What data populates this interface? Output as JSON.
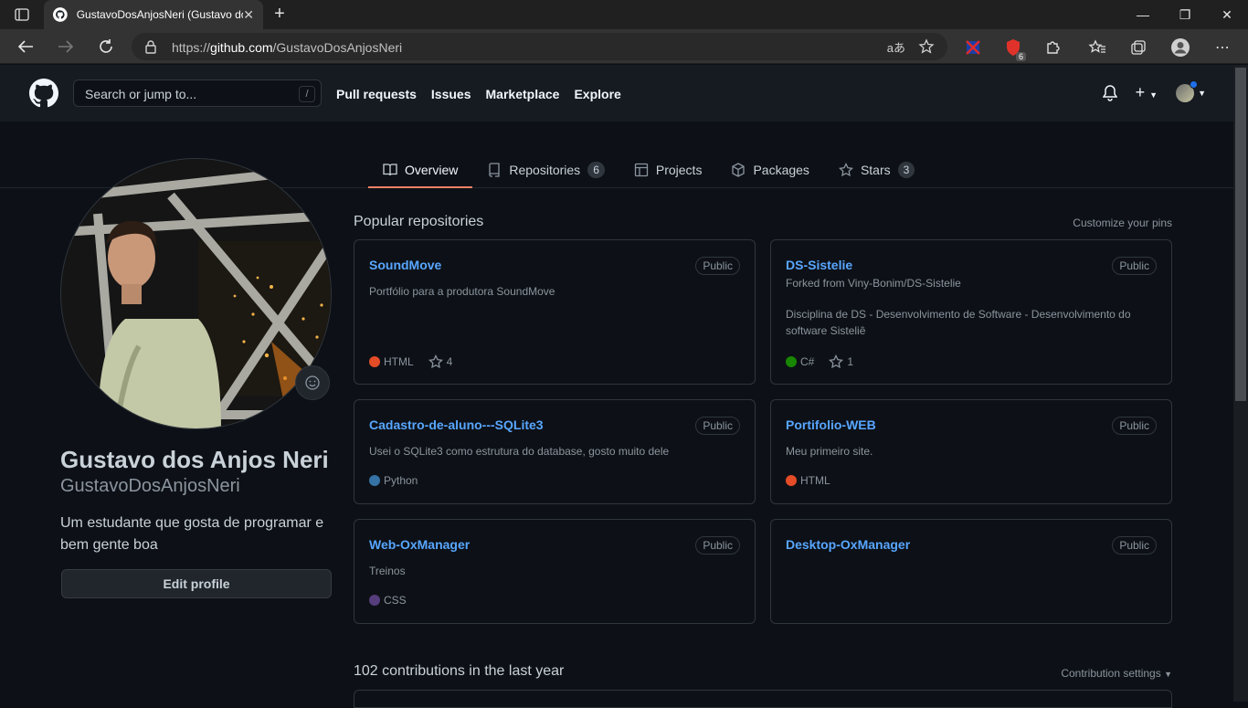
{
  "browser": {
    "tab_title": "GustavoDosAnjosNeri (Gustavo dos Anjos Neri)",
    "url_prefix": "https://",
    "url_host": "github.com",
    "url_path": "/GustavoDosAnjosNeri",
    "read_aloud": "aあ",
    "extension_badge": "6"
  },
  "header": {
    "search_placeholder": "Search or jump to...",
    "search_key": "/",
    "nav": [
      "Pull requests",
      "Issues",
      "Marketplace",
      "Explore"
    ]
  },
  "profile_tabs": [
    {
      "label": "Overview",
      "count": null
    },
    {
      "label": "Repositories",
      "count": "6"
    },
    {
      "label": "Projects",
      "count": null
    },
    {
      "label": "Packages",
      "count": null
    },
    {
      "label": "Stars",
      "count": "3"
    }
  ],
  "profile": {
    "full_name": "Gustavo dos Anjos Neri",
    "username": "GustavoDosAnjosNeri",
    "bio": "Um estudante que gosta de programar e bem gente boa",
    "edit_label": "Edit profile"
  },
  "popular": {
    "title": "Popular repositories",
    "customize": "Customize your pins"
  },
  "repos": [
    {
      "name": "SoundMove",
      "visibility": "Public",
      "forked": "",
      "desc": "Portfólio para a produtora SoundMove",
      "lang": "HTML",
      "lang_color": "#e34c26",
      "stars": "4"
    },
    {
      "name": "DS-Sistelie",
      "visibility": "Public",
      "forked": "Forked from Viny-Bonim/DS-Sistelie",
      "desc": "Disciplina de DS - Desenvolvimento de Software - Desenvolvimento do software Sisteliê",
      "lang": "C#",
      "lang_color": "#178600",
      "stars": "1"
    },
    {
      "name": "Cadastro-de-aluno---SQLite3",
      "visibility": "Public",
      "forked": "",
      "desc": "Usei o SQLite3 como estrutura do database, gosto muito dele",
      "lang": "Python",
      "lang_color": "#3572A5",
      "stars": ""
    },
    {
      "name": "Portifolio-WEB",
      "visibility": "Public",
      "forked": "",
      "desc": "Meu primeiro site.",
      "lang": "HTML",
      "lang_color": "#e34c26",
      "stars": ""
    },
    {
      "name": "Web-OxManager",
      "visibility": "Public",
      "forked": "",
      "desc": "Treinos",
      "lang": "CSS",
      "lang_color": "#563d7c",
      "stars": ""
    },
    {
      "name": "Desktop-OxManager",
      "visibility": "Public",
      "forked": "",
      "desc": "",
      "lang": "",
      "lang_color": "",
      "stars": ""
    }
  ],
  "contributions": {
    "title": "102 contributions in the last year",
    "settings": "Contribution settings"
  }
}
